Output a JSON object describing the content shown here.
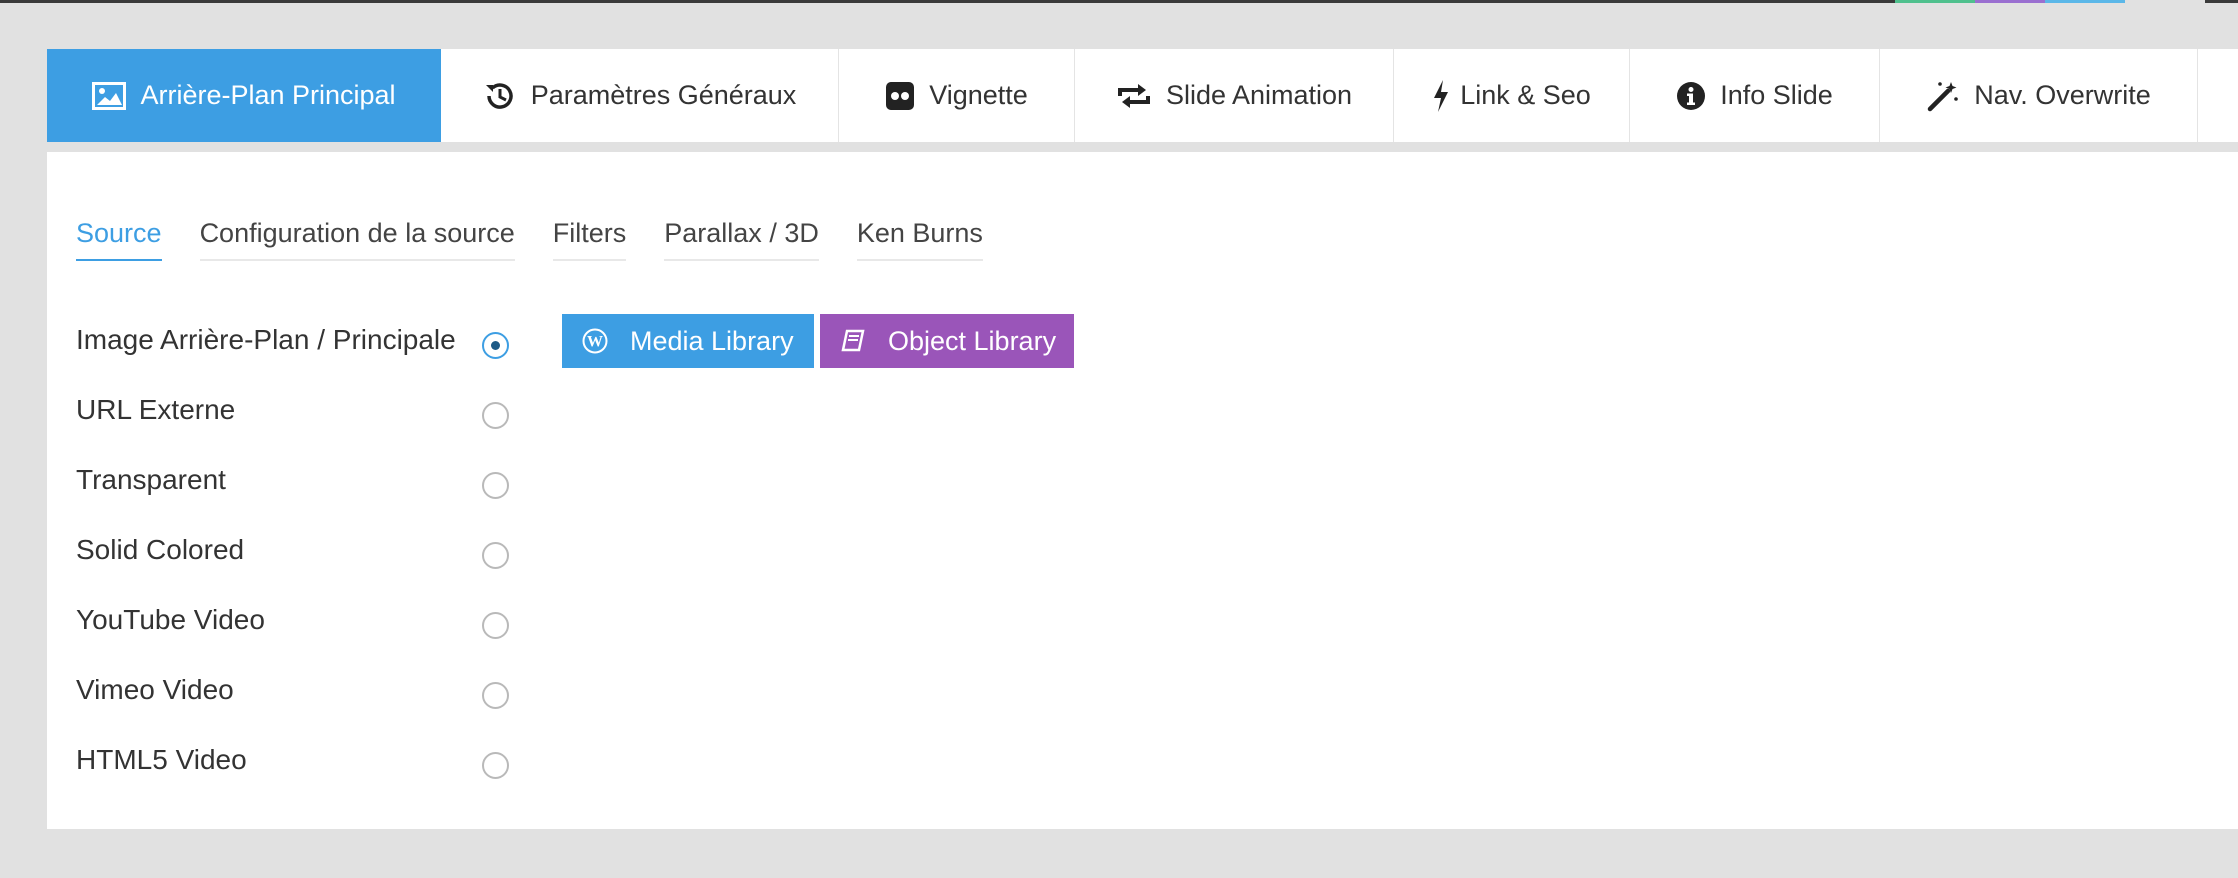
{
  "colors": {
    "accent": "#3d9ee3",
    "purple": "#9a55b9",
    "background": "#e1e1e1"
  },
  "main_tabs": [
    {
      "label": "Arrière-Plan Principal",
      "icon": "image-icon",
      "active": true
    },
    {
      "label": "Paramètres Généraux",
      "icon": "history-icon",
      "active": false
    },
    {
      "label": "Vignette",
      "icon": "flickr-icon",
      "active": false
    },
    {
      "label": "Slide Animation",
      "icon": "loop-icon",
      "active": false
    },
    {
      "label": "Link & Seo",
      "icon": "bolt-icon",
      "active": false
    },
    {
      "label": "Info Slide",
      "icon": "info-icon",
      "active": false
    },
    {
      "label": "Nav. Overwrite",
      "icon": "magic-wand-icon",
      "active": false
    }
  ],
  "sub_tabs": [
    {
      "label": "Source",
      "active": true
    },
    {
      "label": "Configuration de la source",
      "active": false
    },
    {
      "label": "Filters",
      "active": false
    },
    {
      "label": "Parallax / 3D",
      "active": false
    },
    {
      "label": "Ken Burns",
      "active": false
    }
  ],
  "source_options": [
    {
      "label": "Image Arrière-Plan / Principale",
      "checked": true
    },
    {
      "label": "URL Externe",
      "checked": false
    },
    {
      "label": "Transparent",
      "checked": false
    },
    {
      "label": "Solid Colored",
      "checked": false
    },
    {
      "label": "YouTube Video",
      "checked": false
    },
    {
      "label": "Vimeo Video",
      "checked": false
    },
    {
      "label": "HTML5 Video",
      "checked": false
    }
  ],
  "buttons": {
    "media_library": "Media Library",
    "object_library": "Object Library"
  }
}
